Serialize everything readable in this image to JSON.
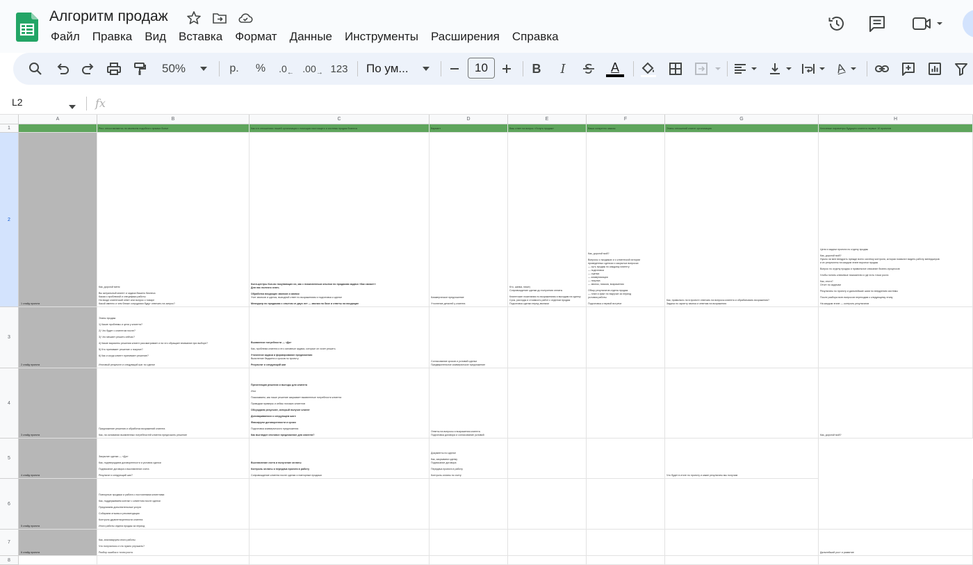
{
  "app": {
    "doc_title": "Алгоритм продаж",
    "menu": [
      "Файл",
      "Правка",
      "Вид",
      "Вставка",
      "Формат",
      "Данные",
      "Инструменты",
      "Расширения",
      "Справка"
    ]
  },
  "toolbar": {
    "zoom": "50%",
    "currency": "р.",
    "percent": "%",
    "decrease_decimals": ".0",
    "increase_decimals": ".00",
    "number_format": "123",
    "font_name": "По ум...",
    "font_size": "10",
    "bold": "B",
    "italic": "I",
    "text_color_glyph": "A",
    "text_rotate_glyph": "A"
  },
  "formula_bar": {
    "name_box": "L2",
    "fx_label": "fx",
    "content": ""
  },
  "columns": [
    "A",
    "B",
    "C",
    "D",
    "E",
    "F",
    "G",
    "H"
  ],
  "rows": [
    {
      "num": "1",
      "cells": [
        {
          "t": []
        },
        {
          "t": [
            {
              "s": "Рюз: отпоставляются ли своевсем подобного прямых болье"
            }
          ]
        },
        {
          "t": [
            {
              "s": "Как и в отношениях нашей организации с помощью настоящего и системы продаж бизнеса"
            }
          ]
        },
        {
          "t": [
            {
              "s": "Вариант"
            }
          ]
        },
        {
          "t": [
            {
              "s": "Ваш ответ на вопрос «Услуга продаж»"
            }
          ]
        },
        {
          "t": [
            {
              "s": "Ваши конкретно заказы"
            }
          ]
        },
        {
          "t": [
            {
              "s": "Этапы отношений клиент организацию"
            }
          ]
        },
        {
          "t": [
            {
              "s": "Ключевые параметры будущего клиента первые 10 проектов"
            }
          ]
        }
      ]
    },
    {
      "num": "2",
      "cells": [
        {
          "seg": "1 слайд проекта",
          "t": []
        },
        {
          "t": [
            {
              "s": "Как, дорогой меня"
            },
            {
              "s": ""
            },
            {
              "s": "Вы актуальный клиент и задача Вашего бизнеса"
            },
            {
              "s": "Какая с проблемой и специфика работы"
            },
            {
              "s": "На входе клиентский ответ или вопрос о товаре"
            },
            {
              "s": "Какой именно и чем ближе сотрудники будут отвечать на запрос?"
            }
          ]
        },
        {
          "t": [
            {
              "s": "Колл-центры Кол-во покупающих их, как с пожизненным опытом по продажам задачи «Как сможет»",
              "b": true
            },
            {
              "s": "Для нас полезно знать",
              "b": true
            },
            {
              "s": ""
            },
            {
              "s": "Обработка входящих звонков и заявок",
              "b": true
            },
            {
              "s": "Учет звонков и сделок, выходной ответ по возражениям и подготовка к сделке"
            },
            {
              "s": ""
            },
            {
              "s": "Менеджер по продажам с опытом от двух лет — звонки по базе и ответы на входящие",
              "b": true
            }
          ]
        },
        {
          "t": [
            {
              "s": "Коммерческое предложение"
            },
            {
              "s": ""
            },
            {
              "s": "Уточнение деталей у клиента"
            }
          ]
        },
        {
          "t": [
            {
              "s": "Кто, шапка, ниже)"
            },
            {
              "s": "Сопровождение сделки до получения оплаты"
            },
            {
              "s": ""
            },
            {
              "s": "Клиентские пожелания по возражениям и выходам на сделку"
            },
            {
              "s": "Срок, расходы и стоимость работ с отделом продаж"
            },
            {
              "s": "Подготовка сделки перед звонком"
            }
          ]
        },
        {
          "t": [
            {
              "s": "Как, дорогой мой?"
            },
            {
              "s": ""
            },
            {
              "s": "Вопросы о продажах и о клиентской истории"
            },
            {
              "s": "проведенных сделках и закрытых вопросах"
            },
            {
              "s": "— суть продаж по каждому клиенту"
            },
            {
              "s": "— подготовка"
            },
            {
              "s": "— оценка"
            },
            {
              "s": "— коммуникация"
            },
            {
              "s": "— покупка"
            },
            {
              "s": "— звонок, письма, возражения"
            },
            {
              "s": ""
            },
            {
              "s": "Обзор результатов отдела продаж"
            },
            {
              "s": "— план и факт по выручке за период"
            },
            {
              "s": "условия работы"
            },
            {
              "s": ""
            },
            {
              "s": "Подготовка к первой встрече"
            }
          ]
        },
        {
          "t": [
            {
              "s": "Как, правильно ли в проекте отвечать на вопросы клиента и обрабатывать возражения?"
            },
            {
              "s": "Задача по скрипту звонка и ответам на возражения"
            }
          ]
        },
        {
          "t": [
            {
              "s": "Цели и задачи проекта по отделу продаж"
            },
            {
              "s": ""
            },
            {
              "s": "Как, дорогой мой?"
            },
            {
              "s": "Нужно ли мне внедрить прежде всего систему контроля, которая позволит видеть работу менеджеров"
            },
            {
              "s": "и их результаты на каждом этапе воронки продаж"
            },
            {
              "s": ""
            },
            {
              "s": "Вопрос по отделу продаж и правильное описание бизнес-процессов"
            },
            {
              "s": ""
            },
            {
              "s": "Чтобы понять ключевые показатели и где есть точки роста"
            },
            {
              "s": ""
            },
            {
              "s": "Как, итоги?"
            },
            {
              "s": "Отчет по задачам"
            },
            {
              "s": ""
            },
            {
              "s": "Результаты по проекту и дальнейшие шаги по внедрению системы"
            },
            {
              "s": ""
            },
            {
              "s": "После разбора всех вопросов переходим к следующему этапу"
            },
            {
              "s": ""
            },
            {
              "s": "На каждом этапе — контроль результатов"
            }
          ]
        }
      ]
    },
    {
      "num": "3",
      "cells": [
        {
          "seg": "2 слайд проекта",
          "t": []
        },
        {
          "t": [
            {
              "s": "Этапы продаж:"
            },
            {
              "s": ""
            },
            {
              "s": "1) Какие проблемы и цели у клиента?"
            },
            {
              "s": ""
            },
            {
              "s": "2) Что будет с клиентом после?"
            },
            {
              "s": ""
            },
            {
              "s": "3) Что мешает решить сейчас?"
            },
            {
              "s": ""
            },
            {
              "s": "4) Какие варианты решения клиент рассматривает и на что обращает внимание при выборе?"
            },
            {
              "s": ""
            },
            {
              "s": "5) Кто принимает решение о покупке?"
            },
            {
              "s": ""
            },
            {
              "s": "6) Как и когда клиент принимает решение?"
            },
            {
              "s": ""
            },
            {
              "s": ""
            },
            {
              "s": "Итоговый результат и следующий шаг по сделке"
            }
          ]
        },
        {
          "t": [
            {
              "s": "Выявление потребности — «Да»",
              "b": true
            },
            {
              "s": ""
            },
            {
              "s": "Как, проблема клиента и его основные задачи, которые он хочет решить"
            },
            {
              "s": ""
            },
            {
              "s": "Уточнение задачи и формирование предложения",
              "b": true
            },
            {
              "s": "Выяснение бюджета и сроков по проекту"
            },
            {
              "s": ""
            },
            {
              "s": "Результат и следующий шаг",
              "b": true
            }
          ]
        },
        {
          "t": [
            {
              "s": "Согласование сроков и условий сделки"
            },
            {
              "s": "Предварительное коммерческое предложение"
            }
          ]
        },
        {
          "t": []
        },
        {
          "t": []
        },
        {
          "t": []
        },
        {
          "t": []
        }
      ]
    },
    {
      "num": "4",
      "cells": [
        {
          "seg": "3 слайд проекта",
          "t": []
        },
        {
          "t": [
            {
              "s": "Предложение решения и обработка возражений клиента"
            },
            {
              "s": ""
            },
            {
              "s": "Как, на основании выявленных потребностей клиента предложить решение"
            }
          ]
        },
        {
          "t": [
            {
              "s": "Презентация решения и выгоды для клиента",
              "b": true
            },
            {
              "s": ""
            },
            {
              "s": "Итог"
            },
            {
              "s": ""
            },
            {
              "s": "Показываем, как наше решение закрывает выявленные потребности клиента"
            },
            {
              "s": ""
            },
            {
              "s": "Приводим примеры и кейсы похожих клиентов"
            },
            {
              "s": ""
            },
            {
              "s": "Обсуждаем результат, который получит клиент",
              "b": true
            },
            {
              "s": ""
            },
            {
              "s": "Договариваемся о следующем шаге",
              "b": true
            },
            {
              "s": ""
            },
            {
              "s": "Фиксируем договоренности и сроки",
              "b": true
            },
            {
              "s": ""
            },
            {
              "s": "Подготовка коммерческого предложения"
            },
            {
              "s": ""
            },
            {
              "s": "Как выглядит итоговое предложение для клиента?",
              "b": true
            }
          ]
        },
        {
          "t": [
            {
              "s": "Ответы на вопросы и возражения клиента"
            },
            {
              "s": "Подготовка договора и согласование условий"
            }
          ]
        },
        {
          "t": []
        },
        {
          "t": []
        },
        {
          "t": []
        },
        {
          "t": [
            {
              "s": "Как, дорогой мой?"
            }
          ]
        }
      ]
    },
    {
      "num": "5",
      "cells": [
        {
          "seg": "4 слайд проекта",
          "t": []
        },
        {
          "t": [
            {
              "s": "Закрытие сделки — «Да»"
            },
            {
              "s": ""
            },
            {
              "s": "Как, подтверждаем договоренности и условия сделки"
            },
            {
              "s": ""
            },
            {
              "s": "Подписание договора и выставление счета"
            },
            {
              "s": ""
            },
            {
              "s": "Результат и следующий шаг?"
            }
          ]
        },
        {
          "t": [
            {
              "s": "Выставление счета и получение оплаты",
              "b": true
            },
            {
              "s": ""
            },
            {
              "s": "Контроль оплаты и передача проекта в работу",
              "b": true
            },
            {
              "s": ""
            },
            {
              "s": "Сопровождение клиента после сделки и повторные продажи"
            }
          ]
        },
        {
          "t": [
            {
              "s": "Документы по сделке"
            },
            {
              "s": ""
            },
            {
              "s": "Как, закрываем сделку"
            },
            {
              "s": "Подписание договора"
            },
            {
              "s": ""
            },
            {
              "s": "Передача проекта в работу"
            },
            {
              "s": ""
            },
            {
              "s": "Контроль оплаты по счету"
            }
          ]
        },
        {
          "t": []
        },
        {
          "t": []
        },
        {
          "t": [
            {
              "s": "Что будет в итоге по проекту и какие результаты мы получим"
            }
          ]
        }
      ]
    },
    {
      "num": "6",
      "cells": [
        {
          "seg": "5 слайд проекта",
          "t": []
        },
        {
          "t": [
            {
              "s": "Повторные продажи и работа с постоянными клиентами"
            },
            {
              "s": ""
            },
            {
              "s": "Как, поддерживаем контакт с клиентом после сделки"
            },
            {
              "s": ""
            },
            {
              "s": "Предлагаем дополнительные услуги"
            },
            {
              "s": ""
            },
            {
              "s": "Собираем отзывы и рекомендации"
            },
            {
              "s": ""
            },
            {
              "s": "Контроль удовлетворенности клиента"
            },
            {
              "s": ""
            },
            {
              "s": "Итоги работы отдела продаж за период"
            }
          ]
        },
        {
          "t": []
        },
        {
          "t": []
        },
        {
          "t": []
        },
        {
          "t": []
        },
        {
          "t": []
        },
        {
          "t": []
        }
      ]
    },
    {
      "num": "7",
      "cells": [
        {
          "seg": "6 слайд проекта",
          "t": []
        },
        {
          "t": [
            {
              "s": "Как, анализируем итоги работы"
            },
            {
              "s": ""
            },
            {
              "s": "Что получилось и что нужно улучшить?"
            },
            {
              "s": ""
            },
            {
              "s": "Разбор ошибок и точек роста"
            }
          ]
        },
        {
          "t": []
        },
        {
          "t": []
        },
        {
          "t": []
        },
        {
          "t": []
        },
        {
          "t": []
        },
        {
          "t": [
            {
              "s": "Дальнейший рост и развитие"
            }
          ]
        }
      ]
    },
    {
      "num": "8",
      "cells": [
        {
          "t": []
        },
        {
          "t": []
        },
        {
          "t": []
        },
        {
          "t": []
        },
        {
          "t": []
        },
        {
          "t": []
        },
        {
          "t": []
        },
        {
          "t": []
        }
      ]
    }
  ]
}
